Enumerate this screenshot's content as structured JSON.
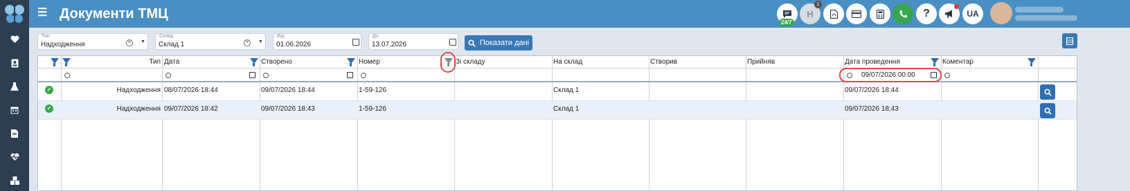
{
  "app": {
    "title": "Документи ТМЦ"
  },
  "header": {
    "chat_badge": "24/7",
    "notification_count": "1",
    "hbtn_h_label": "H",
    "help_label": "?",
    "language": "UA"
  },
  "sidebar": {
    "icons": [
      "heart-icon",
      "id-card-icon",
      "flask-icon",
      "calendar-icon",
      "document-icon",
      "heartbeat-icon",
      "boxes-icon"
    ]
  },
  "filters": {
    "type": {
      "label": "Тип",
      "value": "Надходження"
    },
    "warehouse": {
      "label": "Склад",
      "value": "Склад 1"
    },
    "from": {
      "label": "Від",
      "value": "01.06.2026"
    },
    "to": {
      "label": "До",
      "value": "13.07.2026"
    },
    "show_button": "Показати дані"
  },
  "table": {
    "columns": [
      "Тип",
      "Дата",
      "Створено",
      "Номер",
      "Зі складу",
      "На склад",
      "Створив",
      "Прийняв",
      "Дата проведення",
      "Коментар"
    ],
    "date_filter_value": "09/07/2026 00:00",
    "rows": [
      {
        "type": "Надходження",
        "date": "08/07/2026 18:44",
        "created": "09/07/2026 18:44",
        "number": "1-59-126",
        "from_wh": "",
        "to_wh": "Склад 1",
        "creator": "",
        "acceptor": "",
        "posted": "09/07/2026 18:44",
        "comment": ""
      },
      {
        "type": "Надходження",
        "date": "09/07/2026 18:42",
        "created": "09/07/2026 18:43",
        "number": "1-59-126",
        "from_wh": "",
        "to_wh": "Склад 1",
        "creator": "",
        "acceptor": "",
        "posted": "09/07/2026 18:43",
        "comment": ""
      }
    ]
  },
  "colors": {
    "header": "#4a8fc3",
    "sidebar": "#2c3e50",
    "accent": "#3a78b5",
    "highlight": "#e04848",
    "status_ok": "#3aa647"
  }
}
